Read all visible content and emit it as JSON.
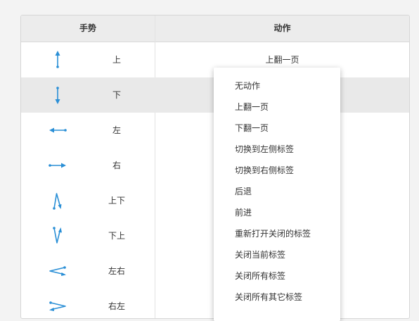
{
  "colors": {
    "arrow": "#2a8fd6",
    "header_bg": "#ececec",
    "highlight": "#e9e9e9"
  },
  "table": {
    "headers": {
      "gesture": "手势",
      "action": "动作"
    },
    "rows": [
      {
        "icon": "arrow-up-icon",
        "gesture": "上",
        "action": "上翻一页"
      },
      {
        "icon": "arrow-down-icon",
        "gesture": "下",
        "action": ""
      },
      {
        "icon": "arrow-left-icon",
        "gesture": "左",
        "action": ""
      },
      {
        "icon": "arrow-right-icon",
        "gesture": "右",
        "action": ""
      },
      {
        "icon": "arrow-up-down-icon",
        "gesture": "上下",
        "action": ""
      },
      {
        "icon": "arrow-down-up-icon",
        "gesture": "下上",
        "action": ""
      },
      {
        "icon": "arrow-left-right-icon",
        "gesture": "左右",
        "action": ""
      },
      {
        "icon": "arrow-right-left-icon",
        "gesture": "右左",
        "action": ""
      }
    ]
  },
  "dropdown": {
    "items": [
      "无动作",
      "上翻一页",
      "下翻一页",
      "切换到左侧标签",
      "切换到右侧标签",
      "后退",
      "前进",
      "重新打开关闭的标签",
      "关闭当前标签",
      "关闭所有标签",
      "关闭所有其它标签"
    ]
  }
}
